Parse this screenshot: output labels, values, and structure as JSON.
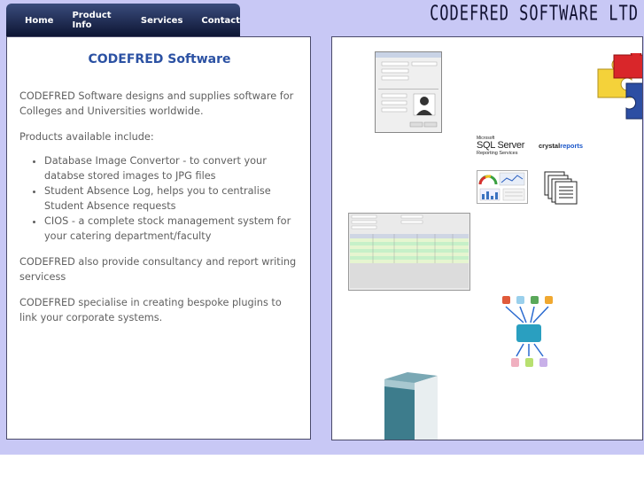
{
  "logo": "CODEFRED SOFTWARE LTD",
  "nav": [
    {
      "label": "Home"
    },
    {
      "label": "Product Info"
    },
    {
      "label": "Services"
    },
    {
      "label": "Contact"
    }
  ],
  "main": {
    "title": "CODEFRED Software",
    "intro": "CODEFRED Software designs and supplies software for Colleges and Universities worldwide.",
    "products_heading": "Products available include:",
    "products": [
      "Database Image Convertor - to convert your databse stored images to JPG files",
      "Student Absence Log, helps you to centralise Student Absence requests",
      "CIOS - a complete stock management system for your catering department/faculty"
    ],
    "consultancy": "CODEFRED also provide consultancy and report writing servicess",
    "plugins": "CODEFRED specialise in creating bespoke plugins to link your corporate systems."
  },
  "gallery": {
    "sqlserver_small": "Microsoft",
    "sqlserver_main": "SQL Server",
    "sqlserver_sub": "Reporting Services",
    "crystal_a": "crystal",
    "crystal_b": "reports"
  },
  "colors": {
    "accent": "#2b51a3",
    "background": "#c8c8f5",
    "nav": "#1a2548"
  }
}
